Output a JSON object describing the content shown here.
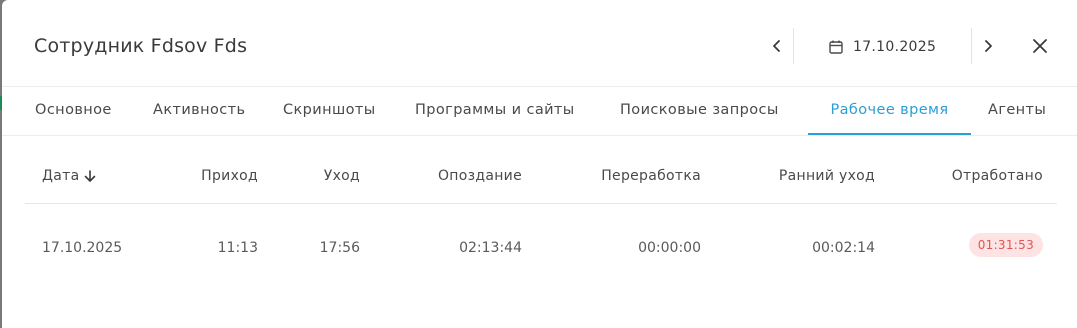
{
  "header": {
    "title": "Сотрудник Fdsov Fds",
    "date": "17.10.2025",
    "icons": {
      "prev": "chevron-left-icon",
      "next": "chevron-right-icon",
      "calendar": "calendar-icon",
      "close": "close-icon"
    }
  },
  "tabs": [
    {
      "label": "Основное",
      "active": false
    },
    {
      "label": "Активность",
      "active": false
    },
    {
      "label": "Скриншоты",
      "active": false
    },
    {
      "label": "Программы и сайты",
      "active": false
    },
    {
      "label": "Поисковые запросы",
      "active": false
    },
    {
      "label": "Рабочее время",
      "active": true
    },
    {
      "label": "Агенты",
      "active": false
    }
  ],
  "table": {
    "columns": [
      "Дата",
      "Приход",
      "Уход",
      "Опоздание",
      "Переработка",
      "Ранний уход",
      "Отработано"
    ],
    "sort_icon": "arrow-down-icon",
    "rows": [
      [
        "17.10.2025",
        "11:13",
        "17:56",
        "02:13:44",
        "00:00:00",
        "00:02:14",
        "01:31:53"
      ]
    ]
  },
  "colors": {
    "accent": "#2a9fd6",
    "badge_bg": "#fde3e3",
    "badge_text": "#e05656"
  }
}
